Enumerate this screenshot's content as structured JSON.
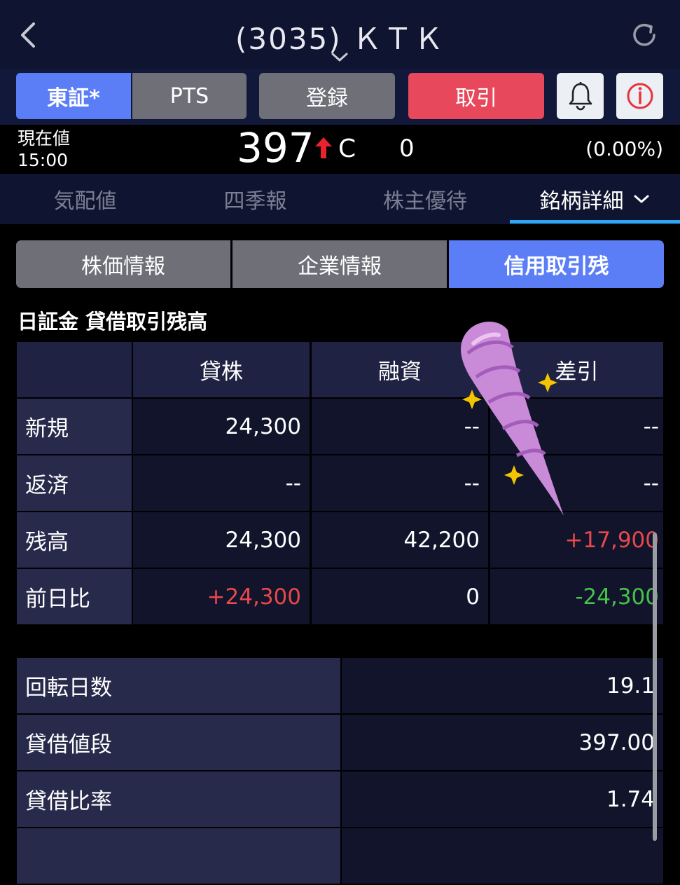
{
  "header": {
    "title": "(3035) ＫＴＫ"
  },
  "toolbar": {
    "tosho": "東証*",
    "pts": "PTS",
    "register": "登録",
    "trade": "取引"
  },
  "price": {
    "label": "現在値",
    "time": "15:00",
    "value": "397",
    "flag": "C",
    "change": "0",
    "change_pct": "(0.00%)"
  },
  "tabs": [
    "気配値",
    "四季報",
    "株主優待",
    "銘柄詳細"
  ],
  "segments": [
    "株価情報",
    "企業情報",
    "信用取引残"
  ],
  "section_title": "日証金 貸借取引残高",
  "table": {
    "headers": [
      "貸株",
      "融資",
      "差引"
    ],
    "rows": [
      {
        "label": "新規",
        "lend": "24,300",
        "loan": "--",
        "diff": "--"
      },
      {
        "label": "返済",
        "lend": "--",
        "loan": "--",
        "diff": "--"
      },
      {
        "label": "残高",
        "lend": "24,300",
        "loan": "42,200",
        "diff": "+17,900"
      },
      {
        "label": "前日比",
        "lend": "+24,300",
        "loan": "0",
        "diff": "-24,300"
      }
    ]
  },
  "stats": [
    {
      "label": "回転日数",
      "value": "19.1"
    },
    {
      "label": "貸借値段",
      "value": "397.00"
    },
    {
      "label": "貸借比率",
      "value": "1.74"
    }
  ],
  "colors": {
    "accent": "#5b7ef6",
    "trade": "#e8485c",
    "up": "#e8484c",
    "down": "#44c249",
    "tab_underline": "#30a6f3"
  },
  "icons": [
    "back-icon",
    "chevron-down-icon",
    "reload-icon",
    "bell-icon",
    "info-icon",
    "up-arrow-icon"
  ]
}
